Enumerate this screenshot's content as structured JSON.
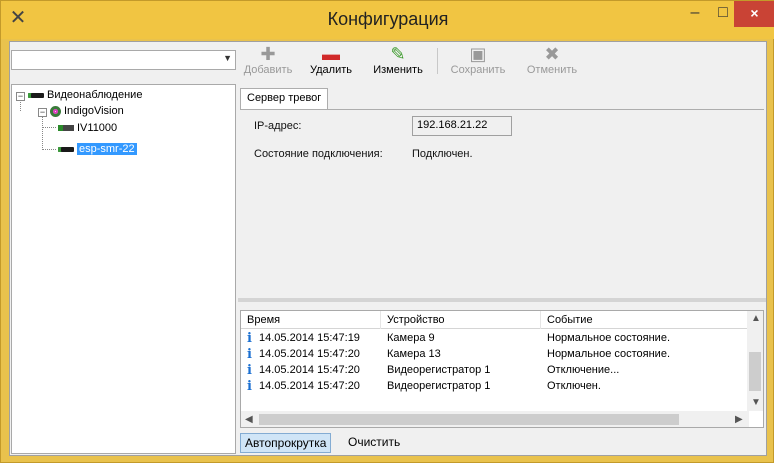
{
  "window": {
    "title": "Конфигурация"
  },
  "titlebar": {
    "min_glyph": "–",
    "max_glyph": "□",
    "close_glyph": "×"
  },
  "left": {
    "combo_value": ""
  },
  "tree": {
    "root": "Видеонаблюдение",
    "server": "IndigoVision",
    "nodes": [
      "IV11000",
      "esp-smr-22"
    ]
  },
  "toolbar": {
    "add": "Добавить",
    "delete": "Удалить",
    "edit": "Изменить",
    "save": "Сохранить",
    "cancel": "Отменить"
  },
  "tab": {
    "label": "Сервер тревог"
  },
  "details": {
    "ip_label": "IP-адрес:",
    "ip_value": "192.168.21.22",
    "status_label": "Состояние подключения:",
    "status_value": "Подключен."
  },
  "log": {
    "columns": [
      "Время",
      "Устройство",
      "Событие"
    ],
    "rows": [
      {
        "time": "14.05.2014 15:47:19",
        "device": "Камера 9",
        "event": "Нормальное состояние."
      },
      {
        "time": "14.05.2014 15:47:20",
        "device": "Камера 13",
        "event": "Нормальное состояние."
      },
      {
        "time": "14.05.2014 15:47:20",
        "device": "Видеорегистратор 1",
        "event": "Отключение..."
      },
      {
        "time": "14.05.2014 15:47:20",
        "device": "Видеорегистратор 1",
        "event": "Отключен."
      }
    ]
  },
  "bottom": {
    "autoscroll": "Автопрокрутка",
    "clear": "Очистить"
  }
}
